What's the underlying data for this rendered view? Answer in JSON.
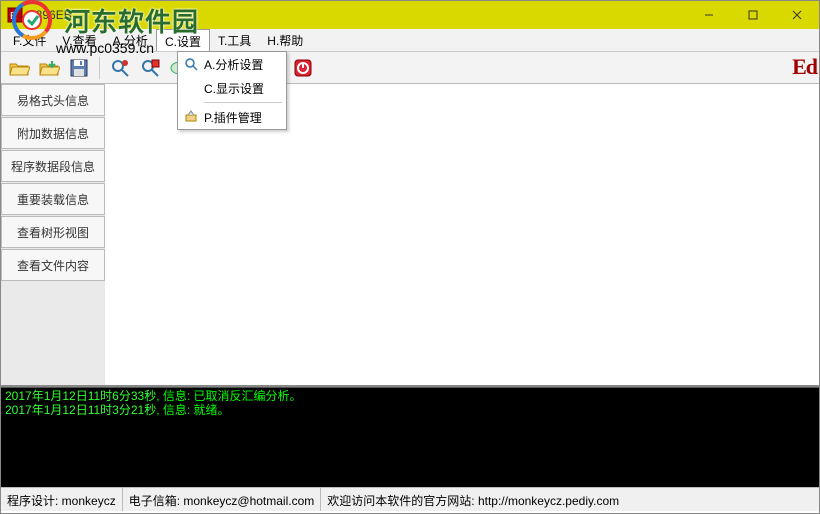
{
  "window": {
    "title": "9896EB"
  },
  "menubar": {
    "items": [
      {
        "label": "F.文件"
      },
      {
        "label": "V.查看"
      },
      {
        "label": "A.分析"
      },
      {
        "label": "C.设置"
      },
      {
        "label": "T.工具"
      },
      {
        "label": "H.帮助"
      }
    ]
  },
  "dropdown": {
    "items": [
      {
        "label": "A.分析设置"
      },
      {
        "label": "C.显示设置"
      },
      {
        "label": "P.插件管理"
      }
    ]
  },
  "sidebar": {
    "tabs": [
      {
        "label": "易格式头信息"
      },
      {
        "label": "附加数据信息"
      },
      {
        "label": "程序数据段信息"
      },
      {
        "label": "重要装载信息"
      },
      {
        "label": "查看树形视图"
      },
      {
        "label": "查看文件内容"
      }
    ]
  },
  "log": {
    "lines": [
      {
        "ts": "2017年1月12日11时6分33秒",
        "sep": ", 信息: ",
        "msg": "已取消反汇编分析。"
      },
      {
        "ts": "2017年1月12日11时3分21秒",
        "sep": ", 信息: ",
        "msg": "就绪。"
      }
    ]
  },
  "status": {
    "designer_label": "程序设计: ",
    "designer_value": "monkeycz",
    "email_label": "电子信箱: ",
    "email_value": "monkeycz@hotmail.com",
    "site_label": "欢迎访问本软件的官方网站: ",
    "site_value": "http://monkeycz.pediy.com"
  },
  "brand": "Ed",
  "watermark": {
    "name": "河东软件园",
    "url": "www.pc0359.cn"
  }
}
